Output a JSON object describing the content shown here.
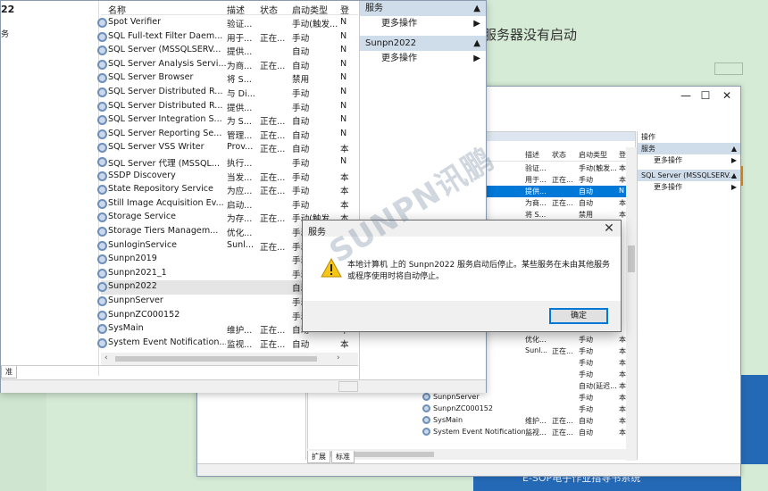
{
  "background": {
    "headline": "服务器没有启动",
    "strip_text": "E-SOP电子作业指导书系统"
  },
  "front": {
    "left_title": "22",
    "left_sub": "务",
    "columns": [
      "名称",
      "描述",
      "状态",
      "启动类型",
      "登"
    ],
    "rows": [
      [
        "Spot Verifier",
        "验证...",
        "",
        "手动(触发...",
        "N"
      ],
      [
        "SQL Full-text Filter Daem...",
        "用于...",
        "正在...",
        "手动",
        "N"
      ],
      [
        "SQL Server (MSSQLSERV...",
        "提供...",
        "",
        "自动",
        "N"
      ],
      [
        "SQL Server Analysis Servi...",
        "为商...",
        "正在...",
        "自动",
        "N"
      ],
      [
        "SQL Server Browser",
        "将 S...",
        "",
        "禁用",
        "N"
      ],
      [
        "SQL Server Distributed R...",
        "与 Di...",
        "",
        "手动",
        "N"
      ],
      [
        "SQL Server Distributed R...",
        "提供...",
        "",
        "手动",
        "N"
      ],
      [
        "SQL Server Integration S...",
        "为 S...",
        "正在...",
        "自动",
        "N"
      ],
      [
        "SQL Server Reporting Se...",
        "管理...",
        "正在...",
        "自动",
        "N"
      ],
      [
        "SQL Server VSS Writer",
        "Prov...",
        "正在...",
        "自动",
        "本"
      ],
      [
        "SQL Server 代理 (MSSQL...",
        "执行...",
        "",
        "手动",
        "N"
      ],
      [
        "SSDP Discovery",
        "当发...",
        "正在...",
        "手动",
        "本"
      ],
      [
        "State Repository Service",
        "为应...",
        "正在...",
        "手动",
        "本"
      ],
      [
        "Still Image Acquisition Ev...",
        "启动...",
        "",
        "手动",
        "本"
      ],
      [
        "Storage Service",
        "为存...",
        "正在...",
        "手动(触发...",
        "本"
      ],
      [
        "Storage Tiers Managem...",
        "优化...",
        "",
        "手动(触发...",
        "本"
      ],
      [
        "SunloginService",
        "Sunl...",
        "正在...",
        "手动",
        "本"
      ],
      [
        "Sunpn2019",
        "",
        "",
        "手动",
        "本"
      ],
      [
        "Sunpn2021_1",
        "",
        "",
        "手动",
        "本"
      ],
      [
        "Sunpn2022",
        "",
        "",
        "自动",
        "本"
      ],
      [
        "SunpnServer",
        "",
        "",
        "手动",
        "本"
      ],
      [
        "SunpnZC000152",
        "",
        "",
        "手动",
        "本"
      ],
      [
        "SysMain",
        "维护...",
        "正在...",
        "自动",
        "本"
      ],
      [
        "System Event Notification...",
        "监视...",
        "正在...",
        "自动",
        "本"
      ]
    ],
    "selected_row": 19,
    "tab_label": "准",
    "actions": {
      "section1": "服务",
      "more1": "更多操作",
      "section2": "Sunpn2022",
      "more2": "更多操作"
    }
  },
  "back": {
    "columns": [
      "名称",
      "描述",
      "状态",
      "启动类型",
      "登"
    ],
    "rows": [
      [
        "",
        "验证...",
        "",
        "手动(触发...",
        "本"
      ],
      [
        "er Daem...",
        "用于...",
        "正在...",
        "手动",
        "本"
      ],
      [
        "SQLSERV...",
        "提供...",
        "",
        "自动",
        "N"
      ],
      [
        "is Servi...",
        "为商...",
        "正在...",
        "自动",
        "本"
      ],
      [
        "",
        "将 S...",
        "",
        "禁用",
        "本"
      ]
    ],
    "lower_rows": [
      [
        "anagem...",
        "优化...",
        "",
        "手动",
        "本"
      ],
      [
        "",
        "Sunl...",
        "正在...",
        "手动",
        "本"
      ],
      [
        "",
        "",
        "",
        "手动",
        "本"
      ],
      [
        "",
        "",
        "",
        "手动",
        "本"
      ],
      [
        "",
        "",
        "",
        "自动(延迟...",
        "本"
      ],
      [
        "SunpnServer",
        "",
        "",
        "手动",
        "本"
      ],
      [
        "SunpnZC000152",
        "",
        "",
        "手动",
        "本"
      ],
      [
        "SysMain",
        "维护...",
        "正在...",
        "自动",
        "本"
      ],
      [
        "System Event Notification...",
        "监视...",
        "正在...",
        "自动",
        "本"
      ]
    ],
    "tabs": [
      "扩展",
      "标准"
    ],
    "actions": {
      "header": "操作",
      "section1": "服务",
      "more1": "更多操作",
      "section2": "SQL Server (MSSQLSERV...",
      "more2": "更多操作"
    }
  },
  "dialog": {
    "title": "服务",
    "message": "本地计算机 上的 Sunpn2022 服务启动后停止。某些服务在未由其他服务或程序使用时将自动停止。",
    "ok_label": "确定"
  },
  "watermark": "SUNPN讯鹏",
  "colors": {
    "selection_blue": "#0078d7",
    "section_header": "#cfdcea",
    "background_green": "#cfe5cf",
    "warning_yellow": "#f5c518"
  }
}
